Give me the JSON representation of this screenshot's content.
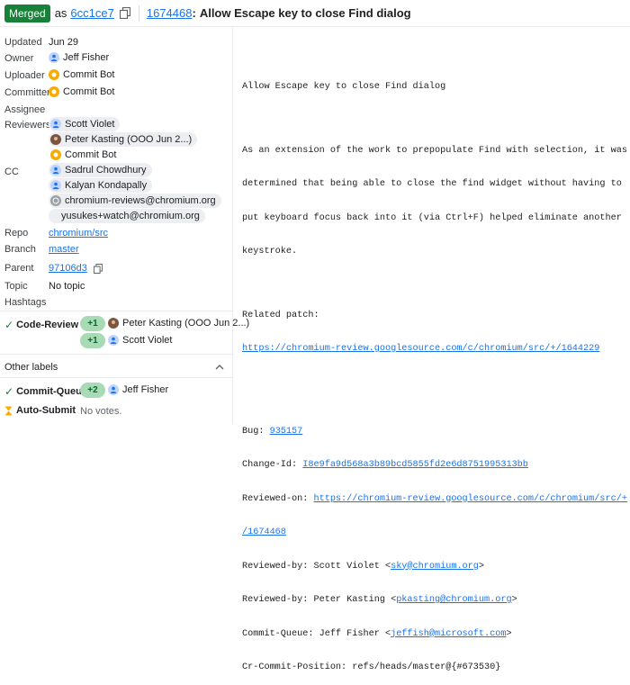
{
  "header": {
    "status_badge": "Merged",
    "as_text": "as",
    "commit": "6cc1ce7",
    "change_number": "1674468",
    "title_sep": ":",
    "title": "Allow Escape key to close Find dialog"
  },
  "metadata": {
    "updated_label": "Updated",
    "updated_value": "Jun 29",
    "owner_label": "Owner",
    "owner_value": "Jeff Fisher",
    "uploader_label": "Uploader",
    "uploader_value": "Commit Bot",
    "committer_label": "Committer",
    "committer_value": "Commit Bot",
    "assignee_label": "Assignee",
    "reviewers_label": "Reviewers",
    "reviewers": [
      "Scott Violet",
      "Peter Kasting (OOO Jun 2...)",
      "Commit Bot"
    ],
    "cc_label": "CC",
    "cc": [
      "Sadrul Chowdhury",
      "Kalyan Kondapally",
      "chromium-reviews@chromium.org",
      "yusukes+watch@chromium.org"
    ],
    "repo_label": "Repo",
    "repo_value": "chromium/src",
    "branch_label": "Branch",
    "branch_value": "master",
    "parent_label": "Parent",
    "parent_value": "97106d3",
    "topic_label": "Topic",
    "topic_value": "No topic",
    "hashtags_label": "Hashtags"
  },
  "labels": {
    "code_review_label": "Code-Review",
    "code_review_votes": [
      {
        "score": "+1",
        "user": "Peter Kasting (OOO Jun 2...)"
      },
      {
        "score": "+1",
        "user": "Scott Violet"
      }
    ],
    "other_labels_title": "Other labels",
    "commit_queue_label": "Commit-Queue",
    "commit_queue_vote": {
      "score": "+2",
      "user": "Jeff Fisher"
    },
    "auto_submit_label": "Auto-Submit",
    "auto_submit_value": "No votes."
  },
  "message": {
    "subject": "Allow Escape key to close Find dialog",
    "body": [
      "As an extension of the work to prepopulate Find with selection, it was",
      "determined that being able to close the find widget without having to",
      "put keyboard focus back into it (via Ctrl+F) helped eliminate another",
      "keystroke."
    ],
    "related_label": "Related patch:",
    "related_url": "https://chromium-review.googlesource.com/c/chromium/src/+/1644229",
    "bug_label": "Bug: ",
    "bug_value": "935157",
    "change_id_label": "Change-Id: ",
    "change_id_value": "I8e9fa9d568a3b89bcd5855fd2e6d8751995313bb",
    "reviewed_on_label": "Reviewed-on: ",
    "reviewed_on_value_1": "https://chromium-review.googlesource.com/c/chromium/src/+",
    "reviewed_on_value_2": "/1674468",
    "reviewed_by_1_label": "Reviewed-by: Scott Violet <",
    "reviewed_by_1_email": "sky@chromium.org",
    "reviewed_by_2_label": "Reviewed-by: Peter Kasting <",
    "reviewed_by_2_email": "pkasting@chromium.org",
    "commit_queue_label": "Commit-Queue: Jeff Fisher <",
    "commit_queue_email": "jeffish@microsoft.com",
    "close_angle": ">",
    "cr_position": "Cr-Commit-Position: refs/heads/master@{#673530}"
  }
}
